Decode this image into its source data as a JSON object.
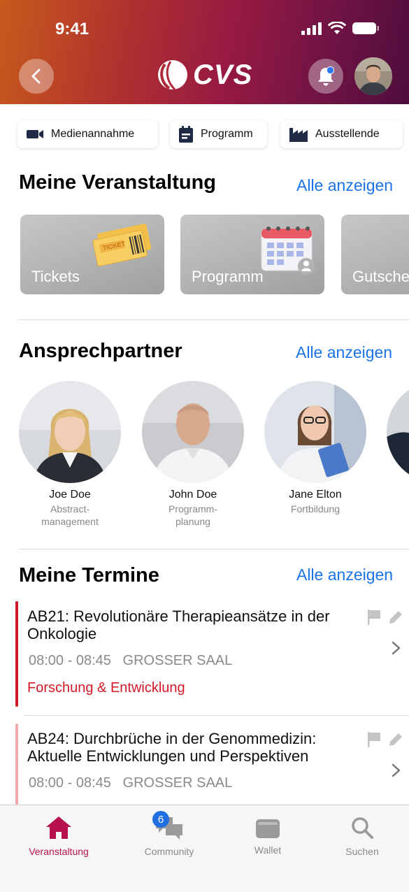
{
  "status_bar": {
    "time": "9:41"
  },
  "header": {
    "logo_text": "CVS"
  },
  "quick_links": [
    {
      "label": "Medienannahme",
      "icon": "video-camera-icon"
    },
    {
      "label": "Programm",
      "icon": "calendar-icon"
    },
    {
      "label": "Ausstellende",
      "icon": "factory-icon"
    }
  ],
  "events": {
    "title": "Meine Veranstaltung",
    "show_all": "Alle anzeigen",
    "tiles": [
      {
        "label": "Tickets",
        "icon": "ticket-icon"
      },
      {
        "label": "Programm",
        "icon": "calendar-icon"
      },
      {
        "label": "Gutsche",
        "icon": "voucher-icon"
      }
    ]
  },
  "contacts": {
    "title": "Ansprechpartner",
    "show_all": "Alle anzeigen",
    "people": [
      {
        "name": "Joe Doe",
        "role": "Abstract-\nmanagement"
      },
      {
        "name": "John Doe",
        "role": "Programm-\nplanung"
      },
      {
        "name": "Jane Elton",
        "role": "Fortbildung"
      }
    ]
  },
  "appointments": {
    "title": "Meine Termine",
    "show_all": "Alle anzeigen",
    "items": [
      {
        "title": "AB21: Revolutionäre Therapieansätze in der Onkologie",
        "time": "08:00 - 08:45",
        "room": "GROSSER SAAL",
        "tag": "Forschung & Entwicklung",
        "accent": "#d31927"
      },
      {
        "title": "AB24: Durchbrüche in der Genommedizin: Aktuelle Entwicklungen und Perspektiven",
        "time": "08:00 - 08:45",
        "room": "GROSSER SAAL",
        "tag": "",
        "accent": "#f0a9a9"
      }
    ]
  },
  "tabbar": {
    "tabs": [
      {
        "label": "Veranstaltung",
        "icon": "home-icon",
        "active": true
      },
      {
        "label": "Community",
        "icon": "chat-icon",
        "badge": "6"
      },
      {
        "label": "Wallet",
        "icon": "wallet-icon"
      },
      {
        "label": "Suchen",
        "icon": "search-icon"
      }
    ]
  },
  "colors": {
    "accent": "#b8124e",
    "link": "#1a73e8",
    "tag": "#d31927"
  }
}
